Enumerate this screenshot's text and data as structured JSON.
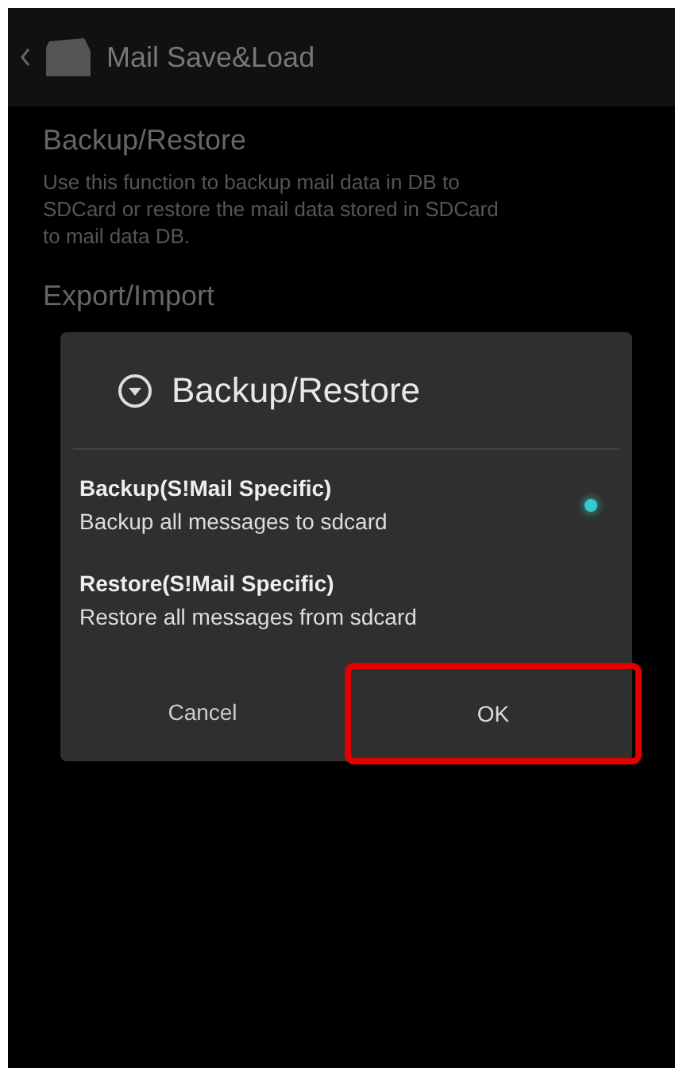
{
  "action_bar": {
    "title": "Mail Save&Load"
  },
  "sections": [
    {
      "title": "Backup/Restore",
      "description": "Use this function to backup mail data in DB to SDCard or restore the mail data stored in SDCard to mail data DB."
    },
    {
      "title": "Export/Import"
    }
  ],
  "dialog": {
    "title": "Backup/Restore",
    "options": [
      {
        "title": "Backup(S!Mail Specific)",
        "subtitle": "Backup all messages to sdcard",
        "selected": true
      },
      {
        "title": "Restore(S!Mail Specific)",
        "subtitle": "Restore all messages from sdcard",
        "selected": false
      }
    ],
    "buttons": [
      {
        "label": "Cancel",
        "highlighted": false
      },
      {
        "label": "OK",
        "highlighted": true
      }
    ]
  }
}
